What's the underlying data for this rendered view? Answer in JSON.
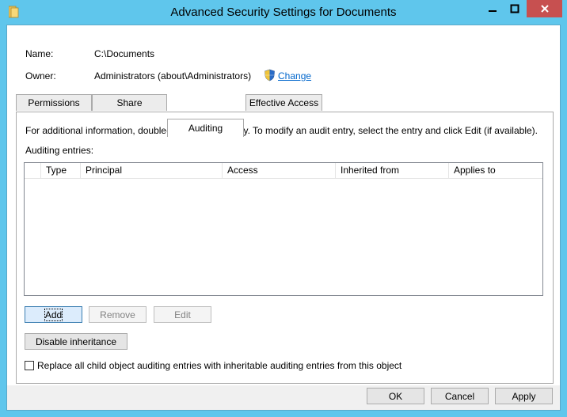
{
  "window": {
    "title": "Advanced Security Settings for Documents",
    "minimize_glyph": "—",
    "maximize_glyph": "□",
    "close_glyph": "✕"
  },
  "info": {
    "name_label": "Name:",
    "name_value": "C:\\Documents",
    "owner_label": "Owner:",
    "owner_value": "Administrators (about\\Administrators)",
    "change_link": "Change"
  },
  "tabs": [
    {
      "label": "Permissions",
      "active": false
    },
    {
      "label": "Share",
      "active": false
    },
    {
      "label": "Auditing",
      "active": true
    },
    {
      "label": "Effective Access",
      "active": false
    }
  ],
  "auditing": {
    "instructions": "For additional information, double-click an audit entry. To modify an audit entry, select the entry and click Edit (if available).",
    "entries_label": "Auditing entries:",
    "columns": [
      "",
      "Type",
      "Principal",
      "Access",
      "Inherited from",
      "Applies to"
    ],
    "entries": []
  },
  "buttons": {
    "add": "Add",
    "remove": "Remove",
    "edit": "Edit",
    "disable_inheritance": "Disable inheritance",
    "ok": "OK",
    "cancel": "Cancel",
    "apply": "Apply"
  },
  "replace_checkbox": {
    "label": "Replace all child object auditing entries with inheritable auditing entries from this object",
    "checked": false
  },
  "colors": {
    "frame": "#5fc6ec",
    "close_button": "#c75050",
    "link": "#0066cc"
  },
  "icons": {
    "app": "folder-icon",
    "change": "uac-shield-icon"
  }
}
